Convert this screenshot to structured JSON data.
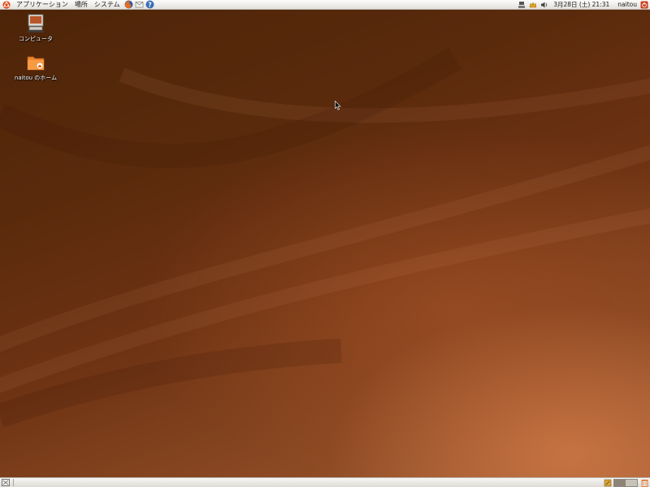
{
  "top_panel": {
    "menus": [
      {
        "label": "アプリケーション"
      },
      {
        "label": "場所"
      },
      {
        "label": "システム"
      }
    ],
    "launchers": [
      "firefox-icon",
      "mail-icon",
      "help-icon"
    ],
    "tray_icons": [
      "network-icon",
      "update-notifier-icon",
      "volume-icon"
    ],
    "clock": "3月28日 (土) 21:31",
    "user": "naitou"
  },
  "desktop": {
    "icons": [
      {
        "label": "コンピュータ",
        "icon": "computer-icon"
      },
      {
        "label": "naitou のホーム",
        "icon": "home-folder-icon"
      }
    ]
  },
  "bottom_panel": {
    "workspaces": 2,
    "active_workspace": 1
  },
  "colors": {
    "panel": "#efedea",
    "wallpaper_dark": "#4d2408",
    "wallpaper_light": "#a55e35",
    "accent_orange": "#e0661b"
  }
}
